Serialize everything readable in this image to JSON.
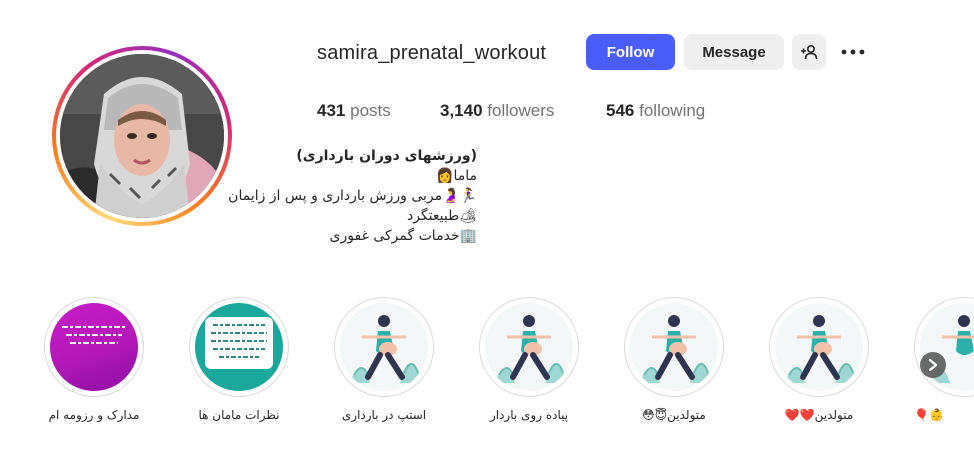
{
  "profile": {
    "username": "samira_prenatal_workout",
    "follow_label": "Follow",
    "message_label": "Message",
    "more_glyph": "•••"
  },
  "stats": {
    "posts_count": "431",
    "posts_label": "posts",
    "followers_count": "3,140",
    "followers_label": "followers",
    "following_count": "546",
    "following_label": "following"
  },
  "bio": {
    "name": "(ورزشهای دوران بارداری)",
    "line1": "ماما👩",
    "line2": "🏃‍♀️🤰مربی ورزش بارداری و پس از زایمان",
    "line3": "🏕طبیعتگرد",
    "line4": "🏢خدمات گمرکی غفوری"
  },
  "highlights": [
    {
      "label": "مدارک و رزومه ام",
      "style": "purple"
    },
    {
      "label": "نظرات مامان ها",
      "style": "teal"
    },
    {
      "label": "استپ در بارداری",
      "style": "yoga"
    },
    {
      "label": "پیاده روی باردار",
      "style": "yoga"
    },
    {
      "label": "متولدین😇😳",
      "style": "yoga"
    },
    {
      "label": "متولدین❤️❤️",
      "style": "yoga"
    },
    {
      "label": "🎈👶",
      "style": "yoga"
    }
  ],
  "colors": {
    "follow_button": "#4a5df9",
    "secondary_button": "#efefef",
    "stat_label": "#737373",
    "highlight_purple": "#b518b9",
    "highlight_teal": "#19a89b"
  },
  "icons": {
    "suggest": "add-person-icon",
    "more": "more-options-icon",
    "scroll": "chevron-right-icon"
  }
}
